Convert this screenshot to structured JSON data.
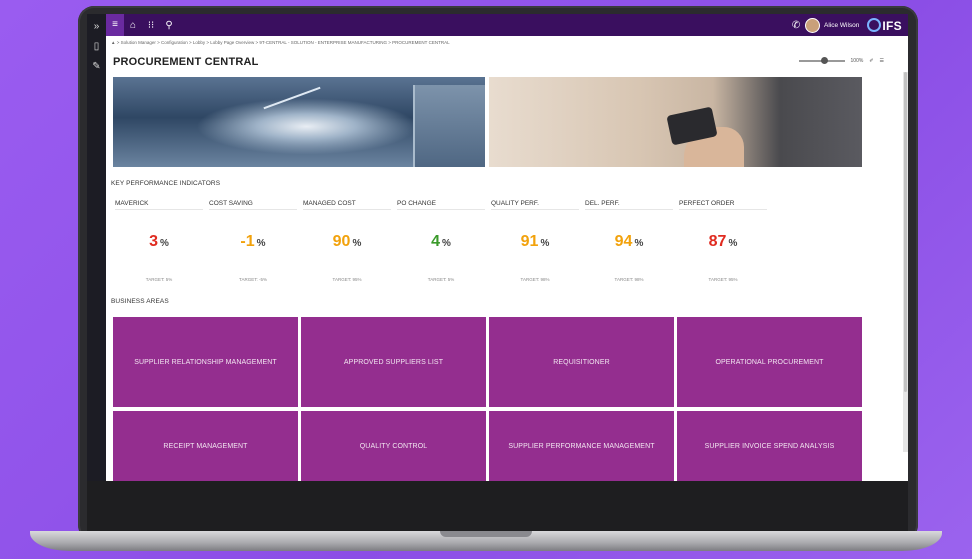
{
  "app": {
    "user_name": "Alice Wilson",
    "logo": "IFS",
    "breadcrumb": "▲ > Solution Manager > Configuration > Lobby > Lobby Page Overview > 9T-CENTRAL - SOLUTION - ENTERPRISE MANUFACTURING > PROCUREMENT CENTRAL",
    "page_title": "PROCUREMENT CENTRAL",
    "zoom_level": "100%",
    "colors": {
      "topbar": "#3a0f5f",
      "tile": "#942e8f",
      "red": "#e02b20",
      "orange": "#f2a20c",
      "green": "#3a9a2a"
    }
  },
  "kpi_section": {
    "heading": "KEY PERFORMANCE INDICATORS",
    "items": [
      {
        "name": "MAVERICK",
        "value": "3",
        "unit": "%",
        "target": "TARGET: 5%",
        "color": "#e02b20"
      },
      {
        "name": "COST SAVING",
        "value": "-1",
        "unit": "%",
        "target": "TARGET: -5%",
        "color": "#f2a20c"
      },
      {
        "name": "MANAGED COST",
        "value": "90",
        "unit": "%",
        "target": "TARGET: 95%",
        "color": "#f2a20c"
      },
      {
        "name": "PO CHANGE",
        "value": "4",
        "unit": "%",
        "target": "TARGET: 5%",
        "color": "#3a9a2a"
      },
      {
        "name": "QUALITY PERF.",
        "value": "91",
        "unit": "%",
        "target": "TARGET: 98%",
        "color": "#f2a20c"
      },
      {
        "name": "DEL. PERF.",
        "value": "94",
        "unit": "%",
        "target": "TARGET: 98%",
        "color": "#f2a20c"
      },
      {
        "name": "PERFECT ORDER",
        "value": "87",
        "unit": "%",
        "target": "TARGET: 95%",
        "color": "#e02b20"
      }
    ]
  },
  "business_areas": {
    "heading": "BUSINESS AREAS",
    "tiles": [
      "SUPPLIER RELATIONSHIP MANAGEMENT",
      "APPROVED SUPPLIERS LIST",
      "REQUISITIONER",
      "OPERATIONAL PROCUREMENT",
      "RECEIPT MANAGEMENT",
      "QUALITY CONTROL",
      "SUPPLIER PERFORMANCE MANAGEMENT",
      "SUPPLIER INVOICE SPEND ANALYSIS"
    ]
  }
}
